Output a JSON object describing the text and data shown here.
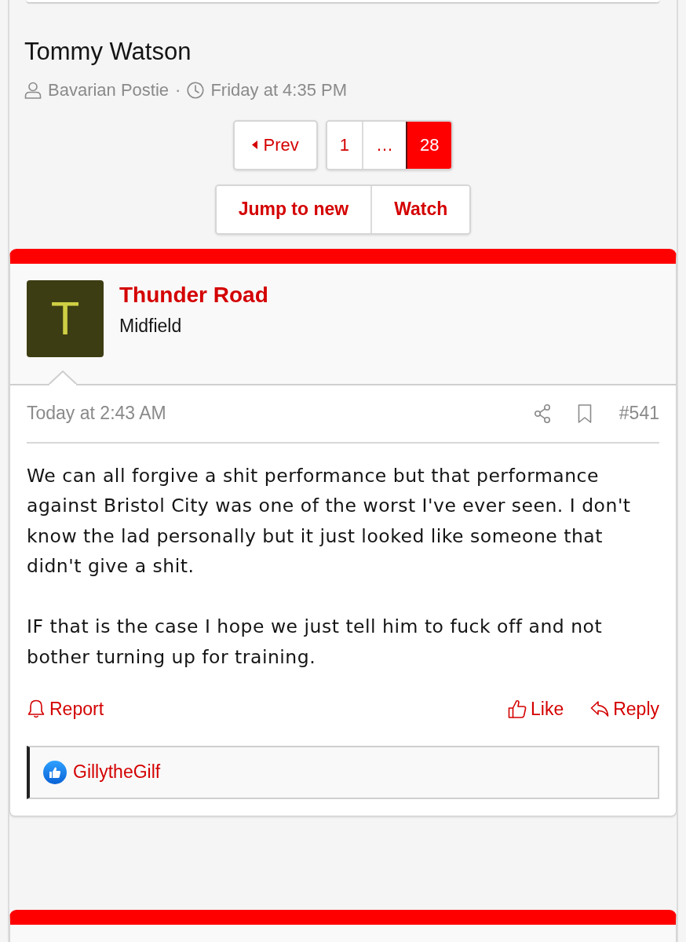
{
  "thread": {
    "title": "Tommy Watson",
    "author": "Bavarian Postie",
    "separator": "·",
    "date": "Friday at 4:35 PM"
  },
  "pagination": {
    "prev": "Prev",
    "pages": [
      {
        "label": "1",
        "selected": false
      },
      {
        "label": "…",
        "selected": false
      },
      {
        "label": "28",
        "selected": true
      }
    ]
  },
  "thread_actions": [
    "Jump to new",
    "Watch"
  ],
  "post": {
    "author": "Thunder Road",
    "role": "Midfield",
    "avatar_letter": "T",
    "time": "Today at 2:43 AM",
    "number": "#541",
    "paragraphs": [
      "We can all forgive a shit performance but that performance against Bristol City was one of the worst I've ever seen. I don't know the lad personally but it just looked like someone that didn't give a shit.",
      "IF that is the case I hope we just tell him to fuck off and not bother turning up for training."
    ],
    "actions_left": [
      {
        "kind": "report",
        "label": "Report"
      }
    ],
    "actions_right": [
      {
        "kind": "like",
        "label": "Like"
      },
      {
        "kind": "reply",
        "label": "Reply"
      }
    ],
    "reactions": {
      "users": [
        "GillytheGilf"
      ]
    }
  }
}
